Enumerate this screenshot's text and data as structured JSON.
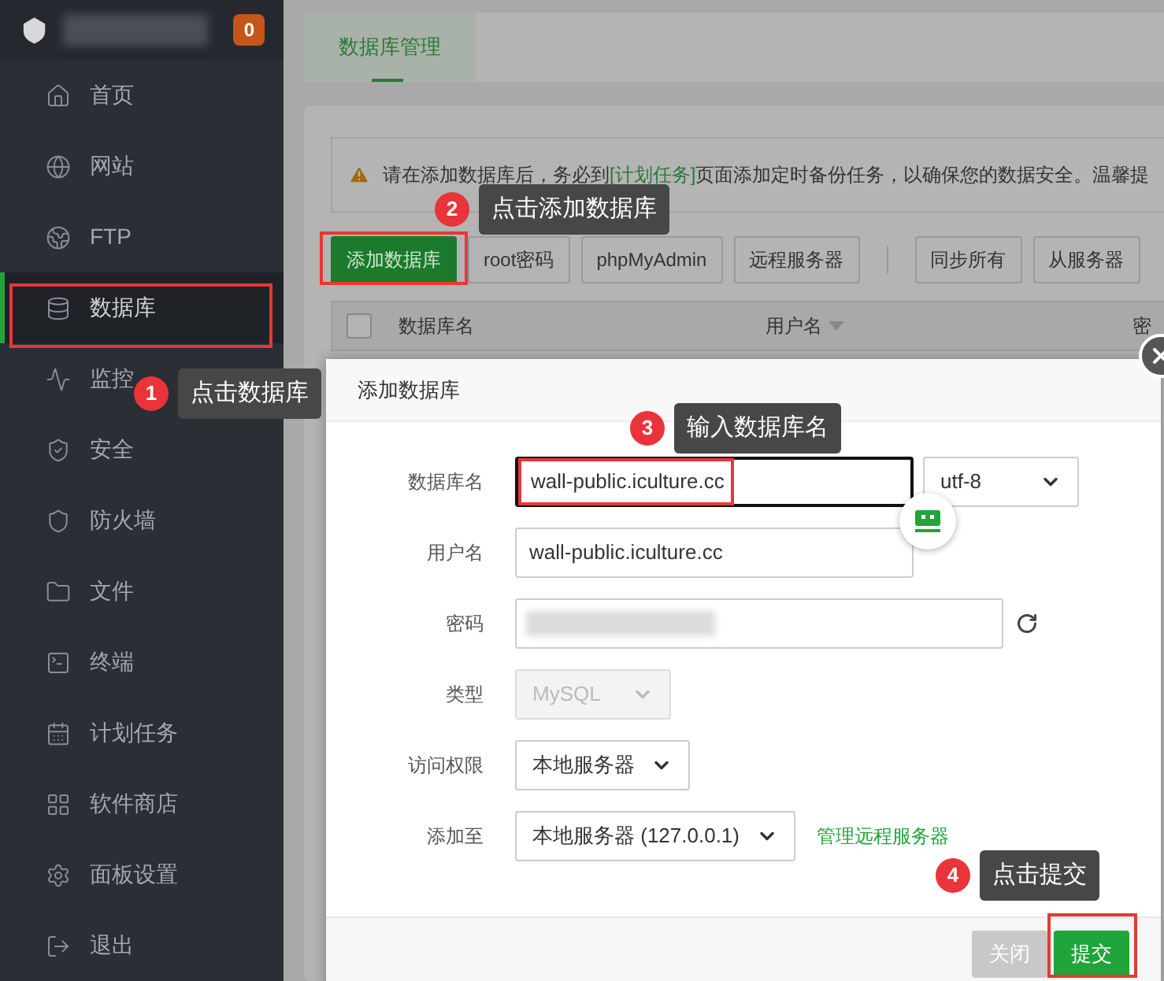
{
  "sidebar": {
    "badge": "0",
    "items": [
      {
        "label": "首页",
        "selected": false
      },
      {
        "label": "网站",
        "selected": false
      },
      {
        "label": "FTP",
        "selected": false
      },
      {
        "label": "数据库",
        "selected": true
      },
      {
        "label": "监控",
        "selected": false
      },
      {
        "label": "安全",
        "selected": false
      },
      {
        "label": "防火墙",
        "selected": false
      },
      {
        "label": "文件",
        "selected": false
      },
      {
        "label": "终端",
        "selected": false
      },
      {
        "label": "计划任务",
        "selected": false
      },
      {
        "label": "软件商店",
        "selected": false
      },
      {
        "label": "面板设置",
        "selected": false
      },
      {
        "label": "退出",
        "selected": false
      }
    ]
  },
  "tabs": [
    {
      "label": "数据库管理",
      "selected": true
    }
  ],
  "notice": {
    "before": "请在添加数据库后，务必到",
    "link": "[计划任务]",
    "after": "页面添加定时备份任务，以确保您的数据安全。温馨提"
  },
  "toolbar": [
    {
      "label": "添加数据库",
      "kind": "primary"
    },
    {
      "label": "root密码",
      "kind": "default"
    },
    {
      "label": "phpMyAdmin",
      "kind": "default"
    },
    {
      "label": "远程服务器",
      "kind": "default"
    },
    {
      "label": "同步所有",
      "kind": "separated"
    },
    {
      "label": "从服务器",
      "kind": "default"
    }
  ],
  "table": {
    "checked": false,
    "columns": [
      {
        "label": "数据库名",
        "sortable": false
      },
      {
        "label": "用户名",
        "sortable": true
      },
      {
        "label": "密",
        "sortable": false
      }
    ]
  },
  "dialog": {
    "title": "添加数据库",
    "rows": [
      {
        "label": "数据库名",
        "controls": [
          {
            "kind": "input",
            "value": "wall-public.iculture.cc",
            "focused": true
          },
          {
            "kind": "select",
            "value": "utf-8",
            "disabled": false
          }
        ]
      },
      {
        "label": "用户名",
        "controls": [
          {
            "kind": "input",
            "value": "wall-public.iculture.cc",
            "focused": false
          }
        ]
      },
      {
        "label": "密码",
        "controls": [
          {
            "kind": "masked"
          }
        ]
      },
      {
        "label": "类型",
        "controls": [
          {
            "kind": "select",
            "value": "MySQL",
            "disabled": true
          }
        ]
      },
      {
        "label": "访问权限",
        "controls": [
          {
            "kind": "select",
            "value": "本地服务器",
            "disabled": false
          }
        ]
      },
      {
        "label": "添加至",
        "controls": [
          {
            "kind": "select",
            "value": "本地服务器 (127.0.0.1)",
            "disabled": false
          },
          {
            "kind": "link",
            "value": "管理远程服务器"
          }
        ]
      }
    ],
    "buttons": [
      {
        "label": "关闭",
        "kind": "secondary"
      },
      {
        "label": "提交",
        "kind": "primary"
      }
    ]
  },
  "annotations": [
    {
      "number": "1",
      "text": "点击数据库"
    },
    {
      "number": "2",
      "text": "点击添加数据库"
    },
    {
      "number": "3",
      "text": "输入数据库名"
    },
    {
      "number": "4",
      "text": "点击提交"
    }
  ]
}
